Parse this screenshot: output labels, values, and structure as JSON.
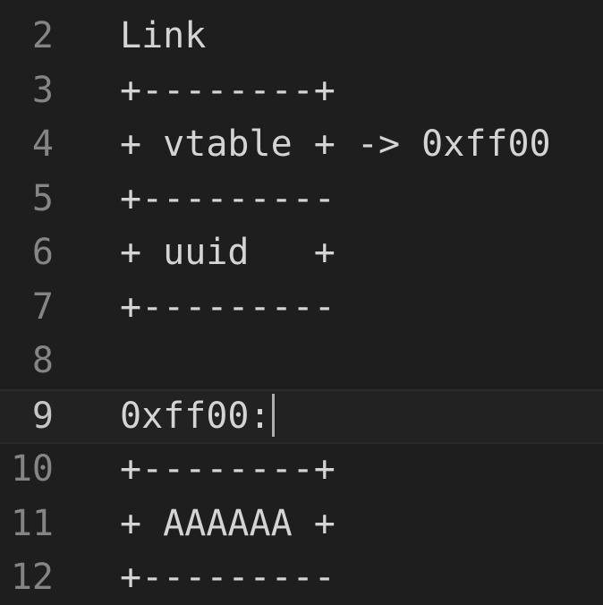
{
  "editor": {
    "colors": {
      "background": "#1e1e1e",
      "text": "#d4d4d4",
      "line_number": "#858585",
      "line_number_active": "#c6c6c6"
    },
    "cursor_line": "9",
    "lines": [
      {
        "number": "2",
        "text": "Link"
      },
      {
        "number": "3",
        "text": "+--------+"
      },
      {
        "number": "4",
        "text": "+ vtable + -> 0xff00"
      },
      {
        "number": "5",
        "text": "+---------"
      },
      {
        "number": "6",
        "text": "+ uuid   +"
      },
      {
        "number": "7",
        "text": "+---------"
      },
      {
        "number": "8",
        "text": ""
      },
      {
        "number": "9",
        "text": "0xff00:"
      },
      {
        "number": "10",
        "text": "+--------+"
      },
      {
        "number": "11",
        "text": "+ AAAAAA +"
      },
      {
        "number": "12",
        "text": "+---------"
      }
    ]
  }
}
